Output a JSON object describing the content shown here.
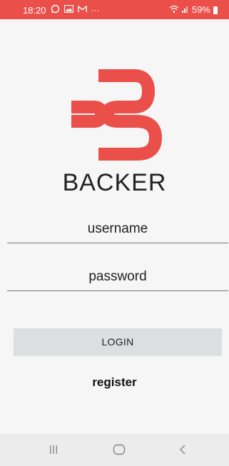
{
  "status_bar": {
    "time": "18:20",
    "more_indicator": "···",
    "battery_percent": "59%"
  },
  "app": {
    "name": "BACKER",
    "brand_color": "#ea4f4a"
  },
  "form": {
    "username_placeholder": "username",
    "password_placeholder": "password",
    "login_label": "LOGIN",
    "register_label": "register"
  },
  "nav": {
    "recent_icon": "recent-apps-icon",
    "home_icon": "home-icon",
    "back_icon": "back-icon"
  }
}
